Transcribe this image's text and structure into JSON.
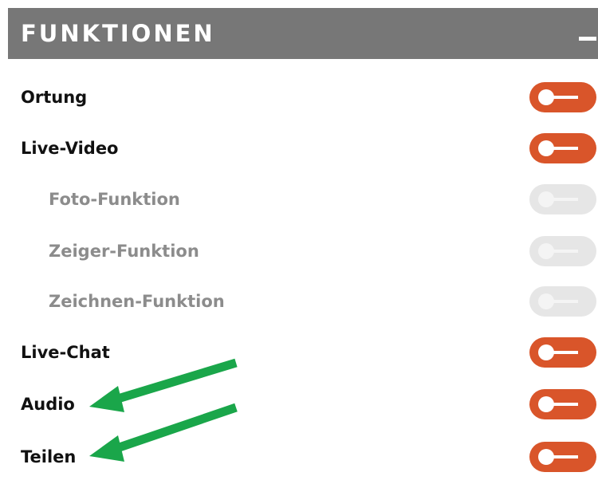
{
  "panel": {
    "title": "FUNKTIONEN",
    "collapse_icon": "minus-icon"
  },
  "items": [
    {
      "label": "Ortung",
      "enabled": true,
      "sub": false
    },
    {
      "label": "Live-Video",
      "enabled": true,
      "sub": false
    },
    {
      "label": "Foto-Funktion",
      "enabled": false,
      "sub": true
    },
    {
      "label": "Zeiger-Funktion",
      "enabled": false,
      "sub": true
    },
    {
      "label": "Zeichnen-Funktion",
      "enabled": false,
      "sub": true
    },
    {
      "label": "Live-Chat",
      "enabled": true,
      "sub": false
    },
    {
      "label": "Audio",
      "enabled": true,
      "sub": false
    },
    {
      "label": "Teilen",
      "enabled": true,
      "sub": false
    }
  ],
  "colors": {
    "header_bg": "#777777",
    "toggle_active": "#d9552a",
    "toggle_disabled": "#e6e6e6",
    "annotation_arrow": "#1aa64a"
  }
}
